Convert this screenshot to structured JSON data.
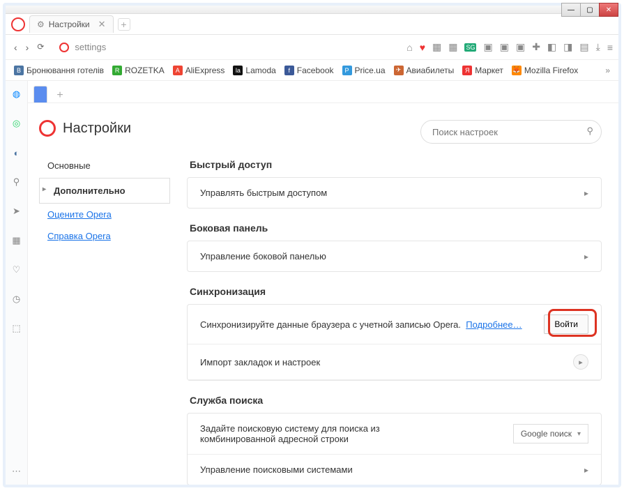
{
  "window": {
    "min": "—",
    "max": "▢",
    "close": "✕"
  },
  "tab": {
    "title": "Настройки",
    "close_glyph": "✕",
    "newtab_glyph": "+"
  },
  "nav": {
    "back": "‹",
    "forward": "›",
    "reload": "⟳",
    "address": "settings"
  },
  "toolbar": {
    "camera": "⌂",
    "heart": "♥",
    "grid1": "▦",
    "grid2": "▦",
    "sg": "SG",
    "badge1": "▣",
    "badge2": "▣",
    "badge3": "▣",
    "puzzle": "✚",
    "i1": "◧",
    "i2": "◨",
    "vpn": "▤",
    "dl": "⤓",
    "menu": "≡"
  },
  "bookmarks": [
    {
      "label": "Бронювання готелів",
      "cls": "vk"
    },
    {
      "label": "ROZETKA",
      "cls": "rz"
    },
    {
      "label": "AliExpress",
      "cls": "ae"
    },
    {
      "label": "Lamoda",
      "cls": "la"
    },
    {
      "label": "Facebook",
      "cls": "fb"
    },
    {
      "label": "Price.ua",
      "cls": "pr"
    },
    {
      "label": "Авиабилеты",
      "cls": "av"
    },
    {
      "label": "Маркет",
      "cls": "ya"
    },
    {
      "label": "Mozilla Firefox",
      "cls": "ff"
    }
  ],
  "bookmarks_more": "»",
  "sidebar_icons": {
    "messenger": "◍",
    "whatsapp": "◎",
    "vk": "◐",
    "search": "⚲",
    "send": "➤",
    "apps": "▦",
    "heart": "♡",
    "history": "◷",
    "box": "⬚",
    "dots": "⋯"
  },
  "mini_add": "+",
  "page": {
    "title": "Настройки"
  },
  "left_nav": {
    "basic": "Основные",
    "advanced": "Дополнительно",
    "rate": "Оцените Opera",
    "help": "Справка Opera"
  },
  "search": {
    "placeholder": "Поиск настроек",
    "icon": "⚲"
  },
  "sections": {
    "speed_dial": {
      "title": "Быстрый доступ",
      "row1": "Управлять быстрым доступом"
    },
    "side_panel": {
      "title": "Боковая панель",
      "row1": "Управление боковой панелью"
    },
    "sync": {
      "title": "Синхронизация",
      "row1_text": "Синхронизируйте данные браузера с учетной записью Opera.",
      "row1_link": "Подробнее…",
      "row1_button": "Войти",
      "row2": "Импорт закладок и настроек"
    },
    "search_service": {
      "title": "Служба поиска",
      "row1": "Задайте поисковую систему для поиска из комбинированной адресной строки",
      "row1_select": "Google поиск",
      "row2": "Управление поисковыми системами"
    }
  },
  "chevron": "▸",
  "chevron_down": "▾"
}
